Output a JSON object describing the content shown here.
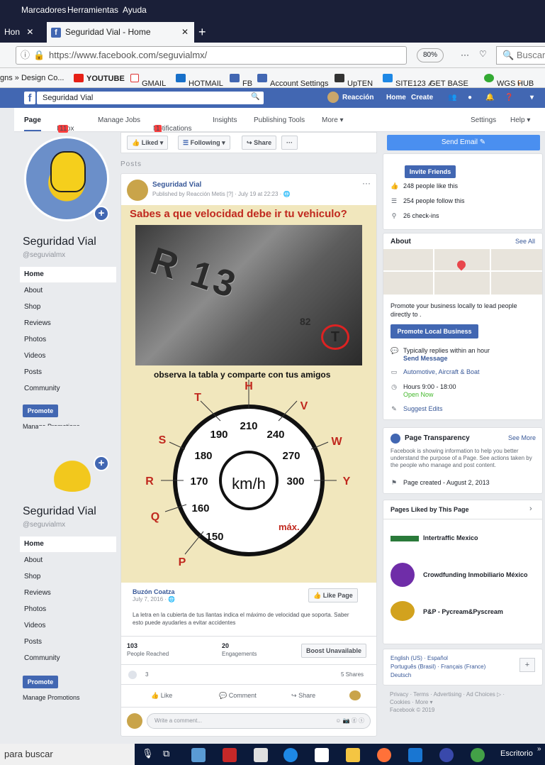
{
  "browser": {
    "menu": [
      "Marcadores",
      "Herramientas",
      "Ayuda"
    ],
    "tabs": [
      {
        "label": "Hon"
      },
      {
        "label": "Seguridad Vial - Home"
      }
    ],
    "url": "https://www.facebook.com/seguvialmx/",
    "zoom": "80%",
    "search_placeholder": "Buscar",
    "bookmarks": [
      "gns » Design Co...",
      "YOUTUBE",
      "GMAIL",
      "HOTMAIL",
      "FB",
      "Account Settings",
      "UpTEN",
      "SITE123",
      "GET BASE",
      "WGS",
      "HUB"
    ]
  },
  "fb": {
    "search_value": "Seguridad Vial",
    "user": "Reacción",
    "nav": [
      "Home",
      "Create"
    ]
  },
  "pagenav": {
    "items": [
      "Page",
      "Inbox",
      "Manage Jobs",
      "Notifications",
      "Insights",
      "Publishing Tools",
      "More ▾",
      "Settings",
      "Help ▾"
    ],
    "inbox_badge": "11",
    "notif_badge": "1"
  },
  "left": {
    "title": "Seguridad Vial",
    "handle": "@seguvialmx",
    "nav": [
      "Home",
      "About",
      "Shop",
      "Reviews",
      "Photos",
      "Videos",
      "Posts",
      "Community"
    ],
    "promote": "Promote",
    "manage": "Manage Promotions"
  },
  "actions": {
    "liked": "Liked ▾",
    "following": "Following ▾",
    "share": "Share",
    "more": "···"
  },
  "posts_label": "Posts",
  "post": {
    "author": "Seguridad Vial",
    "meta": "Published by Reacción Metis [?] · July 19 at 22:23 · ",
    "poster_title": "Sabes a que velocidad debe ir tu vehiculo?",
    "poster_subtitle": "observa la tabla y comparte con tus amigos",
    "tire_letter": "R 13",
    "tire_code": "82",
    "tire_index": "T",
    "dial": {
      "center": "km/h",
      "max": "máx.",
      "speeds": [
        "150",
        "160",
        "170",
        "180",
        "190",
        "210",
        "240",
        "270",
        "300"
      ],
      "letters": [
        "P",
        "Q",
        "R",
        "S",
        "T",
        "H",
        "V",
        "W",
        "Y"
      ]
    },
    "shared_page": "Buzón Coatza",
    "shared_date": "July 7, 2016 · ",
    "like_page": "Like Page",
    "shared_text": "La letra en la cubierta de tus llantas indica el máximo de velocidad que soporta. Saber esto puede ayudarles a evitar accidentes",
    "reached": "103",
    "reached_label": "People Reached",
    "engagements": "20",
    "engagements_label": "Engagements",
    "boost": "Boost Unavailable",
    "reactions": "3",
    "shares": "5 Shares",
    "like": "Like",
    "comment": "Comment",
    "share": "Share",
    "comment_placeholder": "Write a comment..."
  },
  "right": {
    "send_email": "Send Email",
    "invite": "Invite Friends",
    "likes": "248 people like this",
    "follows": "254 people follow this",
    "checkins": "26 check-ins",
    "about_title": "About",
    "see_all": "See All",
    "promote_text": "Promote your business locally to lead people directly to .",
    "promote_btn": "Promote Local Business",
    "replies": "Typically replies within an hour",
    "send_message": "Send Message",
    "category": "Automotive, Aircraft & Boat",
    "hours": "Hours 9:00 - 18:00",
    "open_now": "Open Now",
    "suggest": "Suggest Edits",
    "transparency_title": "Page Transparency",
    "see_more": "See More",
    "transparency_text": "Facebook is showing information to help you better understand the purpose of a Page. See actions taken by the people who manage and post content.",
    "page_created": "Page created - August 2, 2013",
    "liked_title": "Pages Liked by This Page",
    "liked_pages": [
      "Intertraffic Mexico",
      "Crowdfunding Inmobiliario México",
      "P&P - Pycream&Pyscream"
    ],
    "languages": "English (US) · Español",
    "languages2": "Português (Brasil) · Français (France)",
    "languages3": "Deutsch",
    "footer1": "Privacy · Terms · Advertising · Ad Choices ▷ ·",
    "footer2": "Cookies · More ▾",
    "footer3": "Facebook © 2019"
  },
  "taskbar": {
    "search": "para buscar",
    "desktop": "Escritorio"
  },
  "colors": {
    "fb_blue": "#4267b2",
    "poster_bg": "#f1e7bd",
    "poster_red": "#c0281e"
  }
}
